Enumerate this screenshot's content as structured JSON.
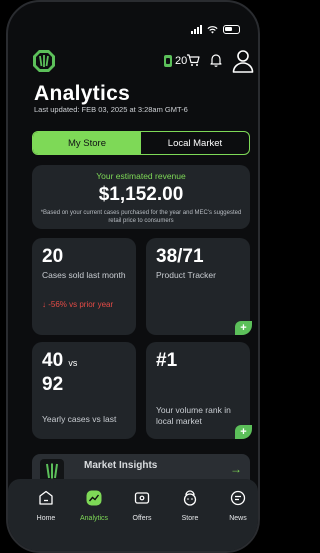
{
  "status_bar": {
    "time": ""
  },
  "header": {
    "cases_count": "20"
  },
  "page": {
    "title": "Analytics",
    "last_updated": "Last updated: FEB 03, 2025 at 3:28am GMT-6"
  },
  "segmented": {
    "tabs": [
      "My Store",
      "Local Market"
    ],
    "active_index": 0
  },
  "revenue": {
    "label": "Your estimated revenue",
    "value": "$1,152.00",
    "note": "*Based on your current cases purchased for the year and MEC's suggested retail price to consumers"
  },
  "stats": [
    {
      "big": "20",
      "sub": "Cases sold last month",
      "change": "↓ -56% vs prior year"
    },
    {
      "big": "38/71",
      "sub": "Product Tracker"
    },
    {
      "big_line1": "40",
      "vs": "vs",
      "big_line2": "92",
      "sub": "Yearly cases vs last"
    },
    {
      "big": "#1",
      "sub": "Your volume rank in local market"
    }
  ],
  "plus_label": "+",
  "insights": {
    "title": "Market Insights"
  },
  "tabbar": {
    "tabs": [
      {
        "label": "Home",
        "icon": "home-icon"
      },
      {
        "label": "Analytics",
        "icon": "analytics-icon",
        "active": true
      },
      {
        "label": "Offers",
        "icon": "offers-icon"
      },
      {
        "label": "Store",
        "icon": "store-icon"
      },
      {
        "label": "News",
        "icon": "news-icon"
      }
    ]
  },
  "colors": {
    "accent": "#7ed957",
    "danger": "#e64b46",
    "card": "#212529",
    "background": "#0c0d0f"
  }
}
